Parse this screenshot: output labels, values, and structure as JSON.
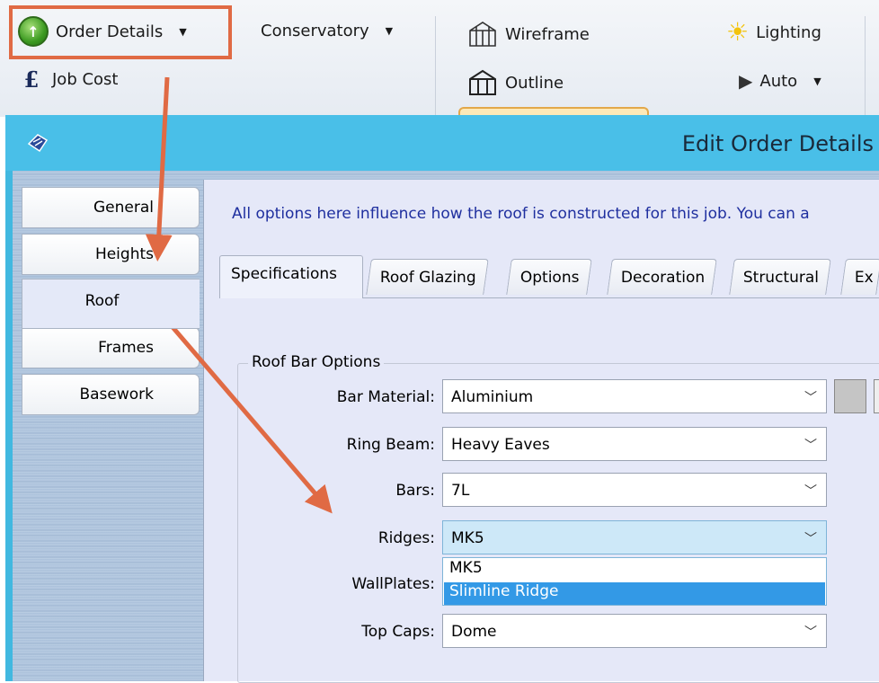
{
  "ribbon": {
    "order_details": "Order Details",
    "job_cost": "Job Cost",
    "conservatory": "Conservatory",
    "wireframe": "Wireframe",
    "outline": "Outline",
    "lighting": "Lighting",
    "auto": "Auto"
  },
  "dialog": {
    "title": "Edit Order Details",
    "left_tabs": [
      "General",
      "Heights",
      "Roof",
      "Frames",
      "Basework"
    ],
    "selected_left_tab": "Roof",
    "info_text": "All options here influence how the roof is constructed for this job. You can a",
    "top_tabs": [
      "Specifications",
      "Roof Glazing",
      "Options",
      "Decoration",
      "Structural",
      "Ex"
    ],
    "selected_top_tab": "Specifications",
    "group_label": "Roof Bar Options",
    "fields": {
      "bar_material": {
        "label": "Bar Material:",
        "value": "Aluminium"
      },
      "ring_beam": {
        "label": "Ring Beam:",
        "value": "Heavy Eaves"
      },
      "bars": {
        "label": "Bars:",
        "value": "7L"
      },
      "ridges": {
        "label": "Ridges:",
        "value": "MK5"
      },
      "wallplates": {
        "label": "WallPlates:"
      },
      "top_caps": {
        "label": "Top Caps:",
        "value": "Dome"
      }
    },
    "ridges_options": [
      "MK5",
      "Slimline Ridge"
    ],
    "highlighted_option": "Slimline Ridge"
  },
  "colors": {
    "annotation": "#e06a44",
    "title_bar": "#49bfe8",
    "highlight": "#3399e6"
  }
}
